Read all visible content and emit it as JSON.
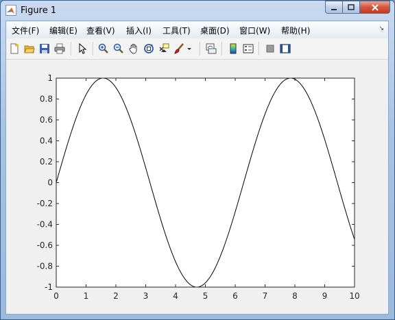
{
  "window": {
    "title": "Figure 1",
    "min_icon": "minimize-icon",
    "max_icon": "maximize-icon",
    "close_icon": "close-icon"
  },
  "menu": {
    "items": [
      "文件(F)",
      "编辑(E)",
      "查看(V)",
      "插入(I)",
      "工具(T)",
      "桌面(D)",
      "窗口(W)",
      "帮助(H)"
    ]
  },
  "toolbar": {
    "buttons": [
      "new-figure-icon",
      "open-file-icon",
      "save-icon",
      "print-icon",
      "edit-plot-arrow-icon",
      "zoom-in-icon",
      "zoom-out-icon",
      "pan-hand-icon",
      "rotate-3d-icon",
      "data-cursor-icon",
      "brush-icon",
      "brush-dropdown-icon",
      "link-plot-icon",
      "colorbar-icon",
      "legend-icon",
      "hide-plot-tools-icon",
      "show-plot-tools-icon"
    ]
  },
  "chart_data": {
    "type": "line",
    "function": "sin(x)",
    "xlim": [
      0,
      10
    ],
    "ylim": [
      -1,
      1
    ],
    "xticks": [
      "0",
      "1",
      "2",
      "3",
      "4",
      "5",
      "6",
      "7",
      "8",
      "9",
      "10"
    ],
    "yticks": [
      "-1",
      "-0.8",
      "-0.6",
      "-0.4",
      "-0.2",
      "0",
      "0.2",
      "0.4",
      "0.6",
      "0.8",
      "1"
    ],
    "x": [
      0,
      0.5,
      1,
      1.5,
      1.5708,
      2,
      2.5,
      3,
      3.5,
      4,
      4.5,
      4.7124,
      5,
      5.5,
      6,
      6.5,
      7,
      7.5,
      7.854,
      8,
      8.5,
      9,
      9.5,
      10
    ],
    "y": [
      0,
      0.479,
      0.841,
      0.997,
      1,
      0.909,
      0.598,
      0.141,
      -0.351,
      -0.757,
      -0.978,
      -1,
      -0.959,
      -0.706,
      -0.279,
      0.215,
      0.657,
      0.938,
      1,
      0.989,
      0.798,
      0.412,
      -0.075,
      -0.544
    ],
    "line_color": "#000000",
    "grid": false
  }
}
